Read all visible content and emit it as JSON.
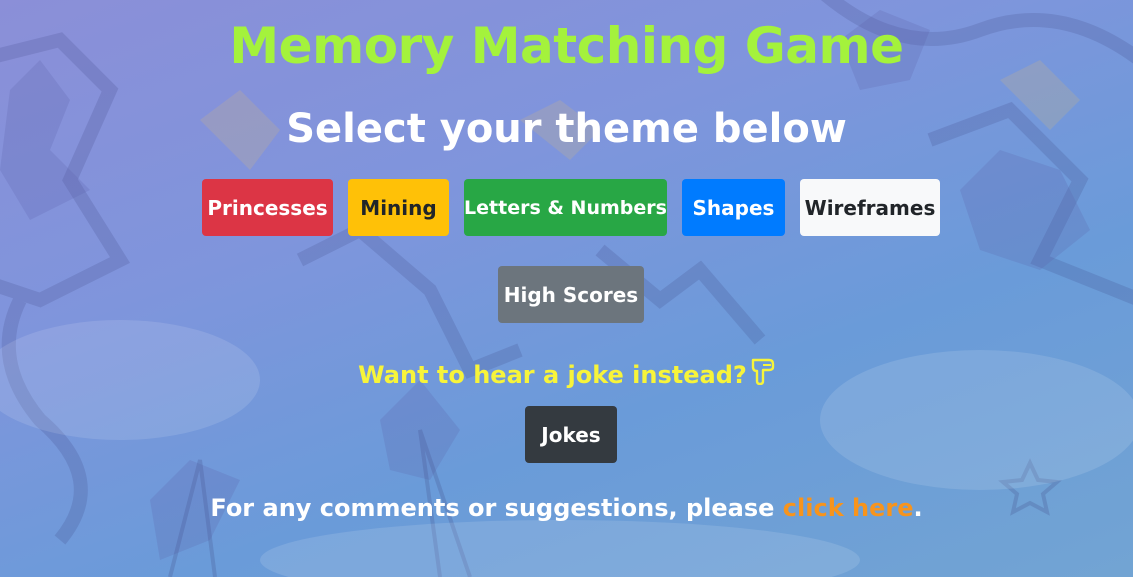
{
  "title": "Memory Matching Game",
  "subtitle": "Select your theme below",
  "themes": [
    {
      "label": "Princesses",
      "color": "#dc3545"
    },
    {
      "label": "Mining",
      "color": "#ffc107"
    },
    {
      "label": "Letters & Numbers",
      "color": "#28a745"
    },
    {
      "label": "Shapes",
      "color": "#007bff"
    },
    {
      "label": "Wireframes",
      "color": "#f8f9fa"
    }
  ],
  "high_scores_label": "High Scores",
  "joke_prompt": "Want to hear a joke instead?",
  "joke_prompt_icon": "pointing-down-hand-icon",
  "jokes_label": "Jokes",
  "footer": {
    "text_before": "For any comments or suggestions, please ",
    "link_text": "click here",
    "text_after": "."
  },
  "colors": {
    "title": "#a4f23c",
    "joke_prompt": "#f7f43a",
    "link": "#f7941d"
  }
}
